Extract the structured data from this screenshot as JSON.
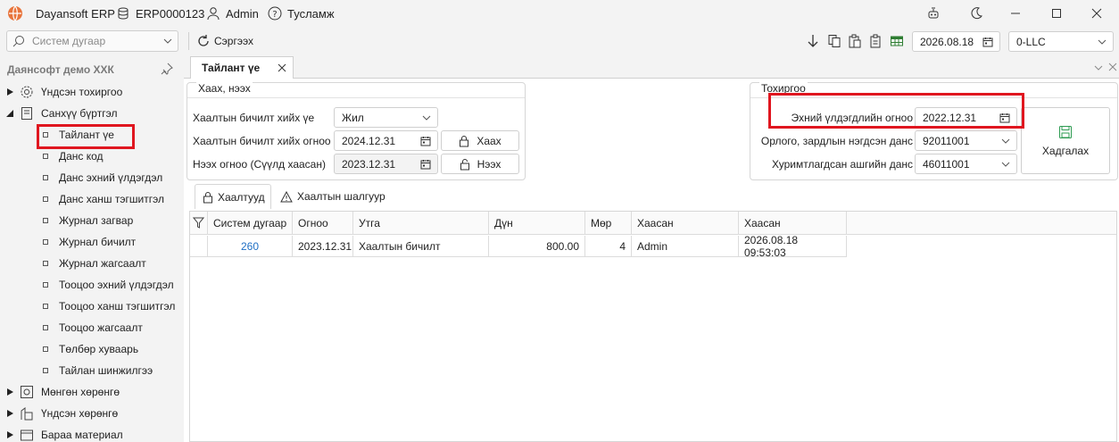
{
  "app": {
    "name": "Dayansoft ERP",
    "db": "ERP0000123",
    "user": "Admin",
    "help": "Тусламж"
  },
  "toolbar": {
    "search_placeholder": "Систем дугаар",
    "refresh_label": "Сэргээх",
    "date": "2026.08.18",
    "company": "0-LLC"
  },
  "sidebar": {
    "title": "Даянсофт демо ХХК",
    "items": [
      {
        "label": "Үндсэн тохиргоо",
        "icon": "gear-icon"
      },
      {
        "label": "Санхүү бүртгэл",
        "icon": "ledger-icon"
      },
      {
        "label": "Тайлант үе"
      },
      {
        "label": "Данс код"
      },
      {
        "label": "Данс эхний үлдэгдэл"
      },
      {
        "label": "Данс ханш тэгшитгэл"
      },
      {
        "label": "Журнал загвар"
      },
      {
        "label": "Журнал бичилт"
      },
      {
        "label": "Журнал жагсаалт"
      },
      {
        "label": "Тооцоо эхний үлдэгдэл"
      },
      {
        "label": "Тооцоо ханш тэгшитгэл"
      },
      {
        "label": "Тооцоо жагсаалт"
      },
      {
        "label": "Төлбөр хуваарь"
      },
      {
        "label": "Тайлан шинжилгээ"
      },
      {
        "label": "Мөнгөн хөрөнгө",
        "icon": "cash-icon"
      },
      {
        "label": "Үндсэн хөрөнгө",
        "icon": "building-icon"
      },
      {
        "label": "Бараа материал",
        "icon": "box-icon"
      }
    ]
  },
  "tab": {
    "title": "Тайлант үе"
  },
  "close_group": {
    "title": "Хаах, нээх",
    "period_label": "Хаалтын бичилт хийх үе",
    "period_value": "Жил",
    "close_date_label": "Хаалтын бичилт хийх огноо",
    "close_date_value": "2024.12.31",
    "close_button": "Хаах",
    "open_date_label": "Нээх огноо (Сүүлд хаасан)",
    "open_date_value": "2023.12.31",
    "open_button": "Нээх"
  },
  "settings_group": {
    "title": "Тохиргоо",
    "initial_balance_label": "Эхний үлдэгдлийн огноо",
    "initial_balance_value": "2022.12.31",
    "income_account_label": "Орлого, зардлын нэгдсэн данс",
    "income_account_value": "92011001",
    "retained_account_label": "Хуримтлагдсан ашгийн данс",
    "retained_account_value": "46011001",
    "save_button": "Хадгалах"
  },
  "subtabs": [
    "Хаалтууд",
    "Хаалтын шалгуур"
  ],
  "grid": {
    "headers": [
      "Систем дугаар",
      "Огноо",
      "Утга",
      "Дүн",
      "Мөр",
      "Хаасан",
      "Хаасан"
    ],
    "rows": [
      [
        "260",
        "2023.12.31",
        "Хаалтын бичилт",
        "800.00",
        "4",
        "Admin",
        "2026.08.18 09:53:03"
      ]
    ]
  },
  "colors": {
    "link": "#1f6fc4",
    "highlight": "#e0161f",
    "save_icon": "#2e9b52"
  }
}
